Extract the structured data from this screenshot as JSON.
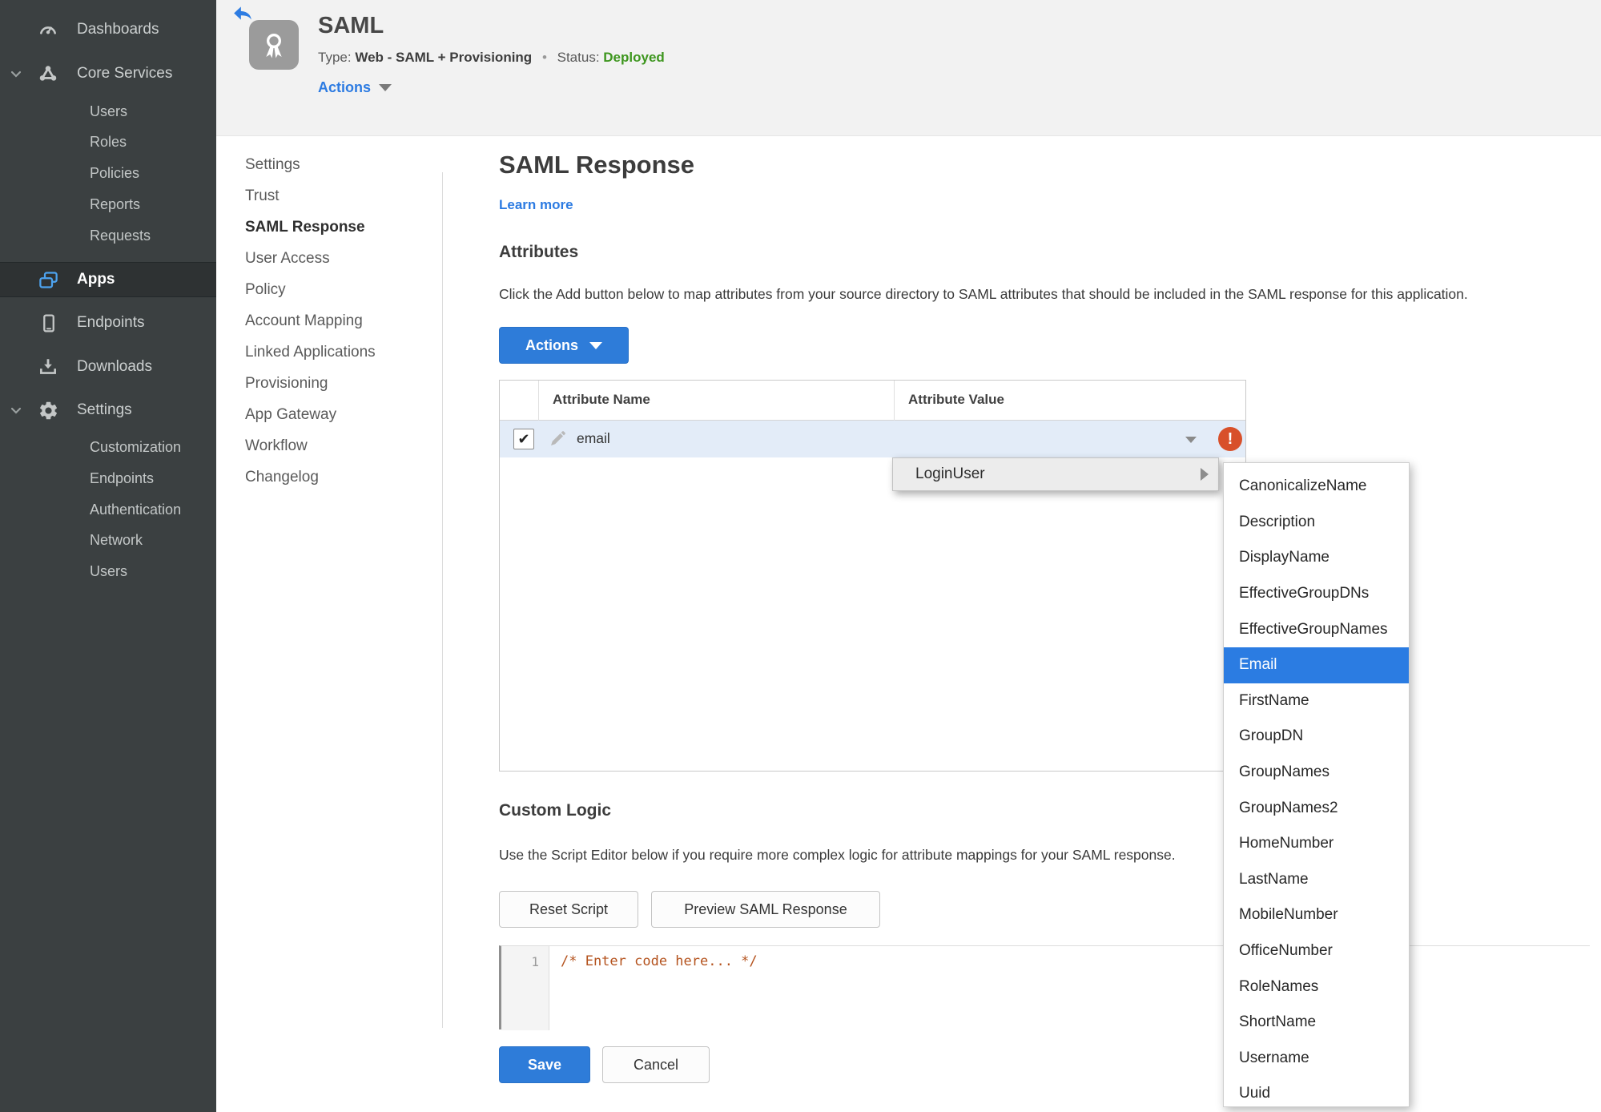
{
  "colors": {
    "accent_blue": "#2E7CD9",
    "link_blue": "#2C7BE2",
    "status_green": "#3E961F",
    "error_red": "#D8502A",
    "sidebar_bg": "#3B4041",
    "sidebar_selected_bg": "#2E3233",
    "row_highlight": "#E3ECF8",
    "menu_highlight_blue": "#2B7CE2",
    "code_comment_orange": "#B4521D"
  },
  "icons": {
    "back": "reply-arrow",
    "app_badge": "ribbon-award",
    "dashboards": "gauge",
    "core_services": "node-cluster",
    "apps": "stacked-windows",
    "endpoints": "mobile-device",
    "downloads": "download-tray",
    "settings": "gear",
    "chevron_down": "v",
    "checkbox_check": "✔",
    "dropdown_caret": "▼",
    "submenu_arrow": "▶",
    "error_badge": "!",
    "edit_pencil": "✎"
  },
  "sidebar": {
    "dashboards": "Dashboards",
    "core_services": "Core Services",
    "core_children": [
      "Users",
      "Roles",
      "Policies",
      "Reports",
      "Requests"
    ],
    "apps": "Apps",
    "endpoints": "Endpoints",
    "downloads": "Downloads",
    "settings": "Settings",
    "settings_children": [
      "Customization",
      "Endpoints",
      "Authentication",
      "Network",
      "Users"
    ]
  },
  "header": {
    "title": "SAML",
    "type_label": "Type:",
    "type_value": "Web - SAML + Provisioning",
    "separator": "•",
    "status_label": "Status:",
    "status_value": "Deployed",
    "actions_label": "Actions"
  },
  "subnav": {
    "active": "SAML Response",
    "items": [
      "Settings",
      "Trust",
      "SAML Response",
      "User Access",
      "Policy",
      "Account Mapping",
      "Linked Applications",
      "Provisioning",
      "App Gateway",
      "Workflow",
      "Changelog"
    ]
  },
  "main": {
    "title": "SAML Response",
    "learn_more": "Learn more",
    "attributes": {
      "heading": "Attributes",
      "description": "Click the Add button below to map attributes from your source directory to SAML attributes that should be included in the SAML response for this application.",
      "actions_button": "Actions",
      "table": {
        "col_name": "Attribute Name",
        "col_value": "Attribute Value",
        "row": {
          "name": "email",
          "value": "",
          "checked": true,
          "error": true
        }
      }
    },
    "menu": {
      "label": "LoginUser",
      "selected": "Email",
      "submenu": [
        "CanonicalizeName",
        "Description",
        "DisplayName",
        "EffectiveGroupDNs",
        "EffectiveGroupNames",
        "Email",
        "FirstName",
        "GroupDN",
        "GroupNames",
        "GroupNames2",
        "HomeNumber",
        "LastName",
        "MobileNumber",
        "OfficeNumber",
        "RoleNames",
        "ShortName",
        "Username",
        "Uuid"
      ]
    },
    "custom_logic": {
      "heading": "Custom Logic",
      "description": "Use the Script Editor below if you require more complex logic for attribute mappings for your SAML response.",
      "reset_button": "Reset Script",
      "preview_button": "Preview SAML Response",
      "editor": {
        "line_number": "1",
        "code": "/* Enter code here... */"
      }
    },
    "save_button": "Save",
    "cancel_button": "Cancel"
  }
}
